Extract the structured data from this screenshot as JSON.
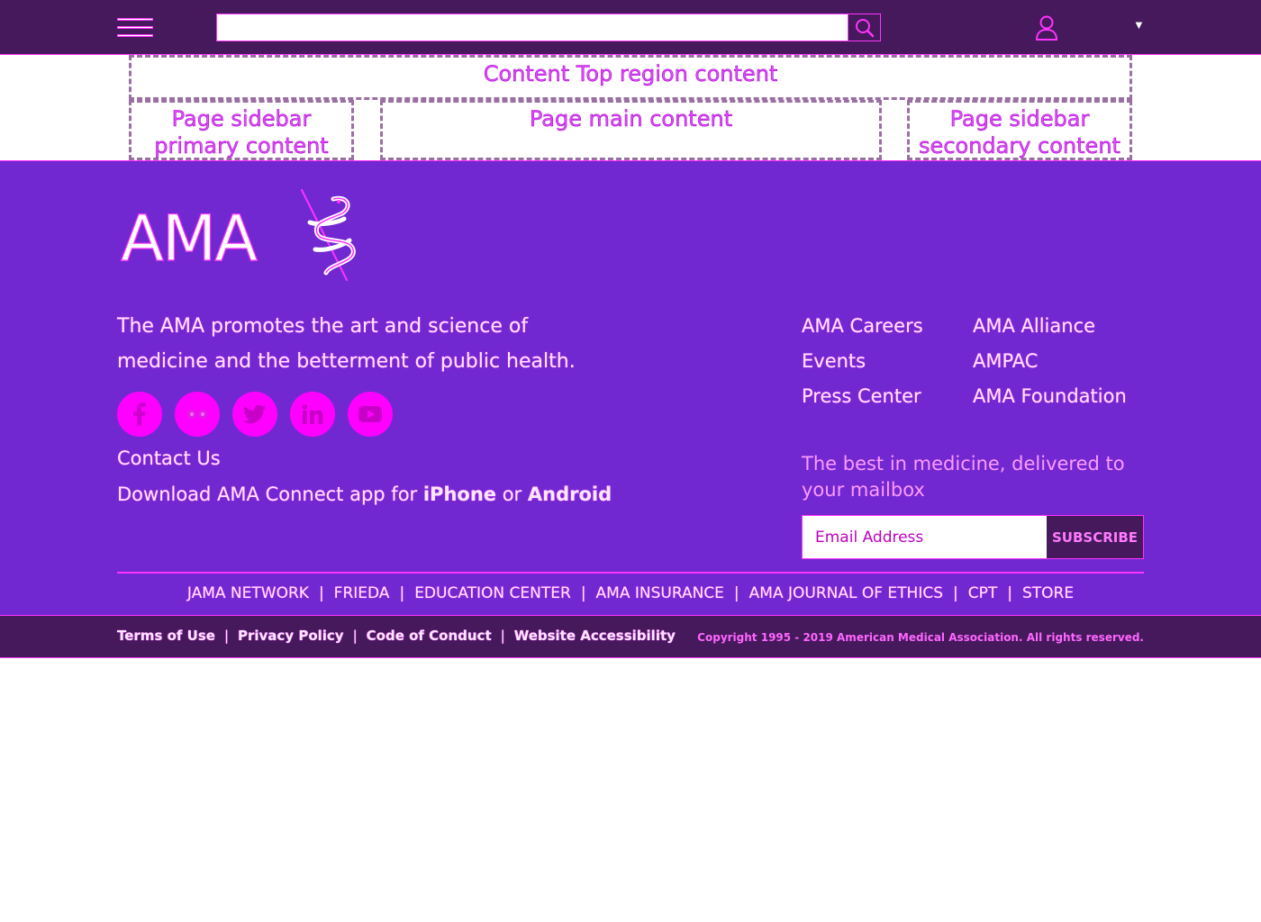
{
  "header": {
    "search_placeholder": "",
    "menu_icon": "hamburger-icon",
    "search_icon": "search-icon",
    "user_icon": "user-icon",
    "dropdown_caret": "▼"
  },
  "regions": {
    "top": "Content Top region content",
    "sidebar_primary": "Page sidebar primary content",
    "main": "Page main content",
    "sidebar_secondary": "Page sidebar secondary content"
  },
  "footer": {
    "logo_text": "AMA",
    "tagline": "The AMA promotes the art and science of medicine and the betterment of public health.",
    "socials": [
      "facebook-icon",
      "flickr-icon",
      "twitter-icon",
      "linkedin-icon",
      "youtube-icon"
    ],
    "contact": "Contact Us",
    "download_prefix": "Download AMA Connect app for ",
    "download_iphone": "iPhone",
    "download_or": " or ",
    "download_android": "Android",
    "links": [
      "AMA Careers",
      "AMA Alliance",
      "Events",
      "AMPAC",
      "Press Center",
      "AMA Foundation"
    ],
    "newsletter_text": "The best in medicine, delivered to your mailbox",
    "email_placeholder": "Email Address",
    "subscribe_label": "SUBSCRIBE",
    "network": [
      "JAMA NETWORK",
      "FRIEDA",
      "EDUCATION CENTER",
      "AMA INSURANCE",
      "AMA JOURNAL OF ETHICS",
      "CPT",
      "STORE"
    ],
    "legal": [
      "Terms of Use",
      "Privacy Policy",
      "Code of Conduct",
      "Website Accessibility"
    ],
    "copyright": "Copyright 1995 - 2019 American Medical Association. All rights reserved."
  },
  "colors": {
    "header_bg": "#45195c",
    "footer_bg": "#7228d1",
    "accent": "#ff33ff"
  }
}
